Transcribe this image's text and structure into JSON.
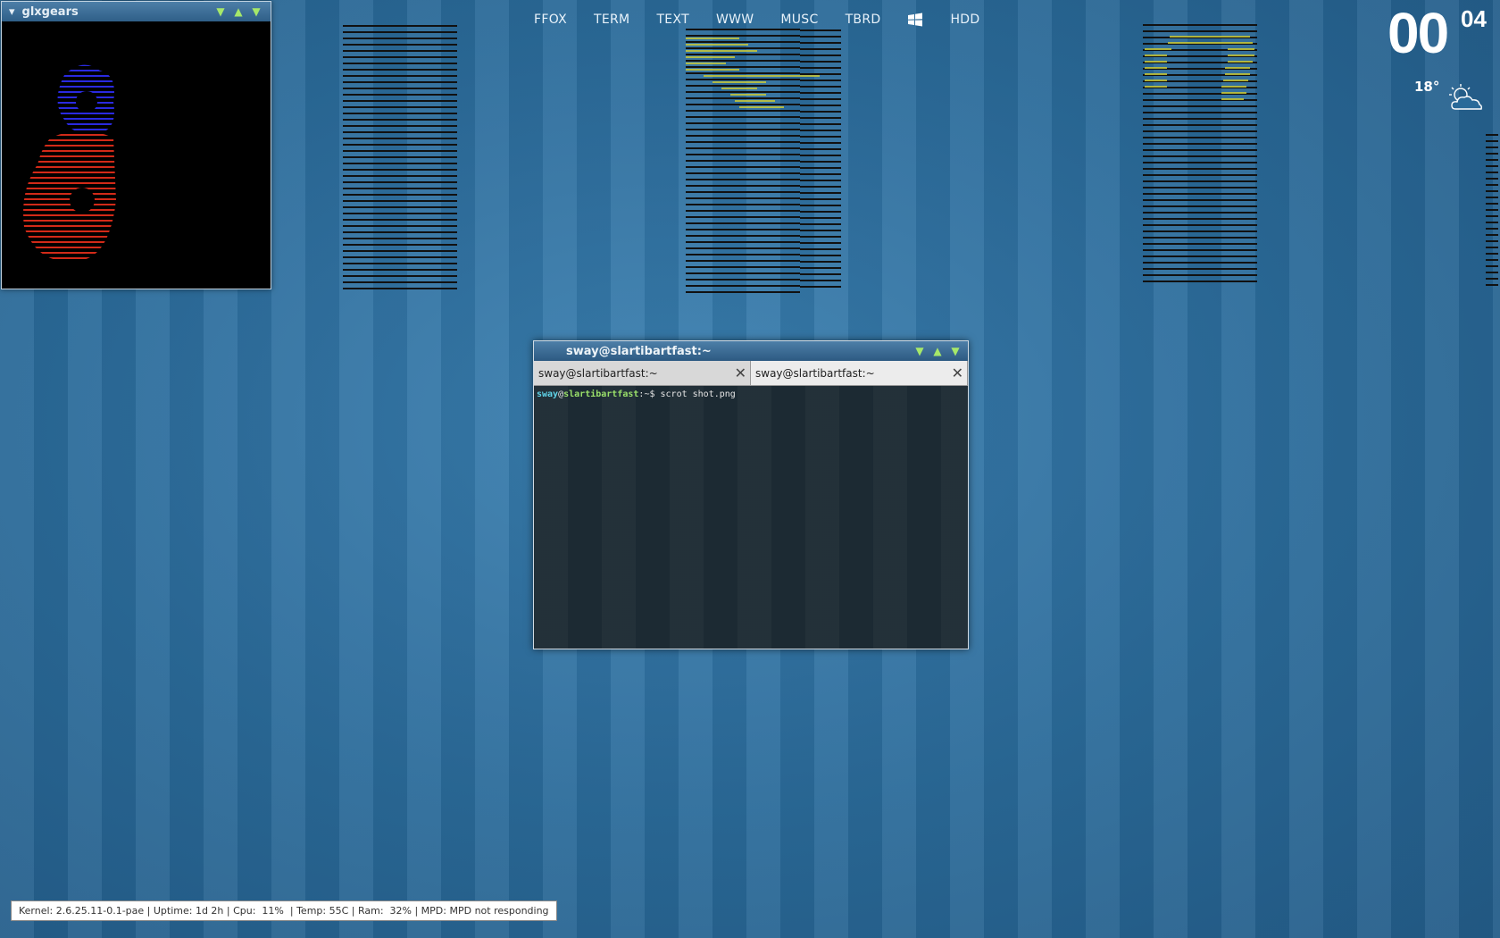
{
  "workspaces": [
    "FFOX",
    "TERM",
    "TEXT",
    "WWW",
    "MUSC",
    "TBRD",
    "HDD"
  ],
  "clock": {
    "hours": "00",
    "minutes": "04"
  },
  "weather": {
    "temp": "18°"
  },
  "glxgears": {
    "title": "glxgears"
  },
  "terminal": {
    "title": "sway@slartibartfast:~",
    "tabs": [
      "sway@slartibartfast:~",
      "sway@slartibartfast:~"
    ],
    "prompt_user": "sway",
    "prompt_at": "@",
    "prompt_host": "slartibartfast",
    "prompt_path": ":~$ ",
    "command": "scrot shot.png"
  },
  "statusbar": {
    "text": "Kernel: 2.6.25.11-0.1-pae | Uptime: 1d 2h | Cpu:  11%  | Temp: 55C | Ram:  32% | MPD: MPD not responding"
  },
  "colors": {
    "desktop_bg": "#2a6a99",
    "titlebar": "#3d6f98",
    "terminal_bg": "#1c2a33",
    "prompt_user": "#5fd3e8",
    "prompt_host": "#9ae06a",
    "button_accent": "#a6e86a"
  }
}
